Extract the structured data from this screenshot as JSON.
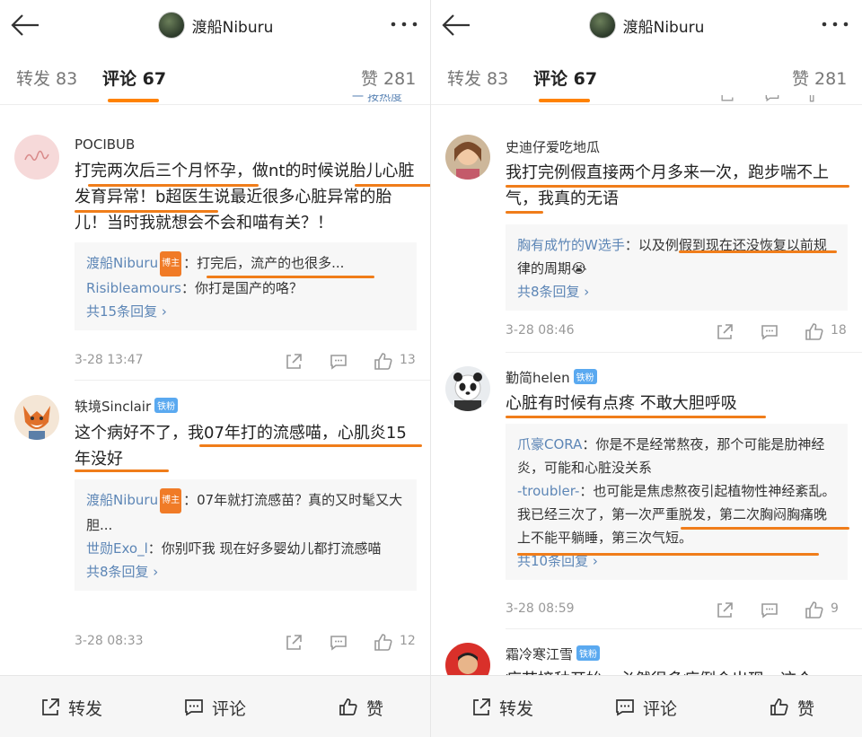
{
  "colors": {
    "accent": "#ff8200",
    "link": "#5d86b6",
    "fan_badge": "#5aa9f0",
    "host_badge": "#f07b27",
    "highlight": "#f07d1a"
  },
  "icons": [
    "back-arrow-icon",
    "more-dots-icon",
    "share-icon",
    "comment-icon",
    "like-icon"
  ],
  "header": {
    "title": "渡船Niburu"
  },
  "tabs": {
    "repost": "转发 83",
    "comments": "评论 67",
    "likes": "赞 281"
  },
  "bottom_bar": {
    "repost": "转发",
    "comment": "评论",
    "like": "赞"
  },
  "left": {
    "partial_top": "一 按热度",
    "comments": [
      {
        "user": "POCIBUB",
        "text": "打完两次后三个月怀孕，做nt的时候说胎儿心脏发育异常！b超医生说最近很多心脏异常的胎儿！当时我就想会不会和喵有关？！",
        "replies": [
          {
            "user": "渡船Niburu",
            "badge": "博主",
            "text": "：打完后，流产的也很多..."
          },
          {
            "user": "Risibleamours",
            "text": "：你打是国产的咯？"
          }
        ],
        "more": "共15条回复 ›",
        "time": "3-28 13:47",
        "likes": "13"
      },
      {
        "user": "轶境Sinclair",
        "fan_badge": "铁粉",
        "text": "这个病好不了，我07年打的流感喵，心肌炎15年没好",
        "replies": [
          {
            "user": "渡船Niburu",
            "badge": "博主",
            "text": "：07年就打流感苗？真的又时髦又大胆..."
          },
          {
            "user": "世勋Exo_l",
            "text": "：你别吓我  现在好多婴幼儿都打流感喵"
          }
        ],
        "more": "共8条回复 ›",
        "time": "3-28 08:33",
        "likes": "12"
      }
    ]
  },
  "right": {
    "comments": [
      {
        "user": "史迪仔爱吃地瓜",
        "text": "我打完例假直接两个月多来一次，跑步喘不上气，我真的无语",
        "replies": [
          {
            "user": "胸有成竹的W选手",
            "text": "：以及例假到现在还没恢复以前规律的周期😭"
          }
        ],
        "more": "共8条回复 ›",
        "time": "3-28 08:46",
        "likes": "18"
      },
      {
        "user": "勤简helen",
        "fan_badge": "铁粉",
        "text": "心脏有时候有点疼 不敢大胆呼吸",
        "replies": [
          {
            "user": "爪豪CORA",
            "text": "：你是不是经常熬夜，那个可能是肋神经炎，可能和心脏没关系"
          },
          {
            "user": "-troubler-",
            "text": "：也可能是焦虑熬夜引起植物性神经紊乱。我已经三次了，第一次严重脱发，第二次胸闷胸痛晚上不能平躺睡，第三次气短。"
          }
        ],
        "more": "共10条回复 ›",
        "time": "3-28 08:59",
        "likes": "9"
      },
      {
        "user": "霜冷寒江雪",
        "fan_badge": "铁粉",
        "text": "疫苗接种开始，必然很多病例会出现，这个"
      }
    ]
  }
}
